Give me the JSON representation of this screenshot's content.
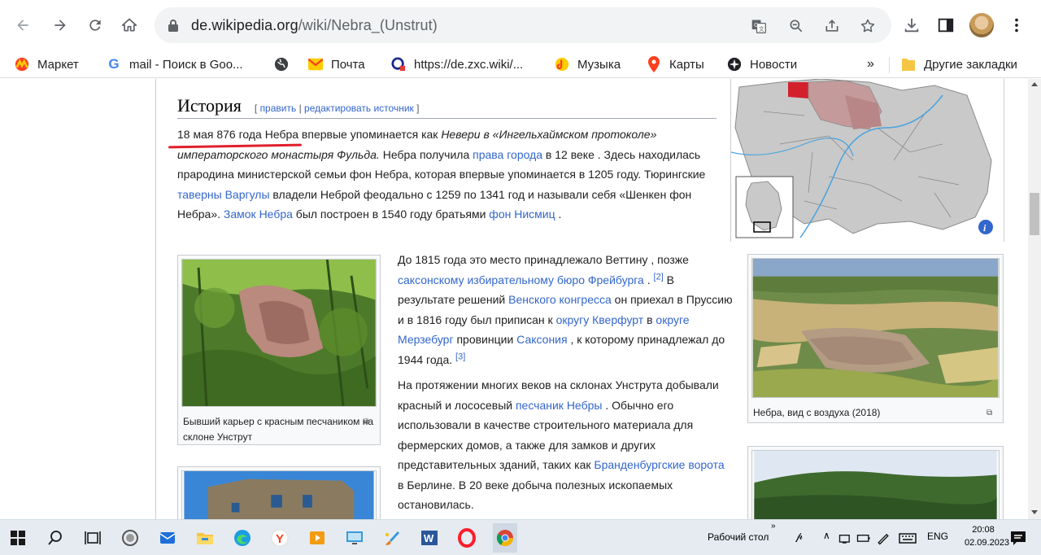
{
  "browser": {
    "url_host": "de.wikipedia.org",
    "url_path": "/wiki/Nebra_(Unstrut)"
  },
  "bookmarks": [
    {
      "label": "Маркет",
      "icon": "market-icon"
    },
    {
      "label": "mail - Поиск в Goo...",
      "icon": "google-icon"
    },
    {
      "label": "",
      "icon": "globe-icon"
    },
    {
      "label": "Почта",
      "icon": "mail-icon"
    },
    {
      "label": "https://de.zxc.wiki/...",
      "icon": "zxc-wiki-icon"
    },
    {
      "label": "Музыка",
      "icon": "music-icon"
    },
    {
      "label": "Карты",
      "icon": "maps-pin-icon"
    },
    {
      "label": "Новости",
      "icon": "news-icon"
    }
  ],
  "bookmarks_more": "»",
  "other_bookmarks": "Другие закладки",
  "article": {
    "section_title": "История",
    "edit_open": "[",
    "edit_link": "править",
    "edit_sep": "|",
    "edit_source_link": "редактировать источник",
    "edit_close": "]",
    "p1": {
      "s1": "18 мая 876 года Небра впервые упоминается как ",
      "i1": "Невери в «Ингельхаймском протоколе» императорского монастыря Фульда.",
      "s2": " Небра получила ",
      "a1": "права города",
      "s3": " в 12 веке . Здесь находилась прародина министерской семьи фон Небра, которая впервые упоминается в 1205 году. Тюрингские ",
      "a2": "таверны Варгулы",
      "s4": " владели Неброй феодально с 1259 по 1341 год и называли себя «Шенкен фон Небра». ",
      "a3": "Замок Небра",
      "s5": " был построен в 1540 году братьями ",
      "a4": "фон Нисмиц",
      "s6": " ."
    },
    "p2": {
      "s1": "До 1815 года это место принадлежало Веттину , позже ",
      "a1": "саксонскому избирательному бюро Фрейбурга",
      "s2": " . ",
      "ref1": "[2]",
      "s3": " В результате решений ",
      "a2": "Венского конгресса",
      "s4": " он приехал в Пруссию и в 1816 году был приписан к ",
      "a3": "округу Кверфурт",
      "s5": " в ",
      "a4": "округе Мерзебург",
      "s6": " провинции ",
      "a5": "Саксония",
      "s7": " , к которому принадлежал до 1944 года. ",
      "ref2": "[3]"
    },
    "p3": {
      "s1": "На протяжении многих веков на склонах Унструта добывали красный и лососевый ",
      "a1": "песчаник Небры",
      "s2": " . Обычно его использовали в качестве строительного материала для фермерских домов, а также для замков и других представительных зданий, таких как ",
      "a2": "Бранденбургские ворота",
      "s3": " в Берлине. В 20 веке добыча полезных ископаемых остановилась."
    },
    "thumb1_caption": "Бывший карьер с красным песчаником на склоне Унструт",
    "thumb2_caption": "Небра, вид с воздуха (2018)"
  },
  "taskbar": {
    "desktop_label": "Рабочий стол",
    "desktop_chevron": "»",
    "ime": "ENG",
    "time": "20:08",
    "date": "02.09.2023"
  },
  "colors": {
    "link": "#3366cc",
    "underline": "#e0202c"
  }
}
